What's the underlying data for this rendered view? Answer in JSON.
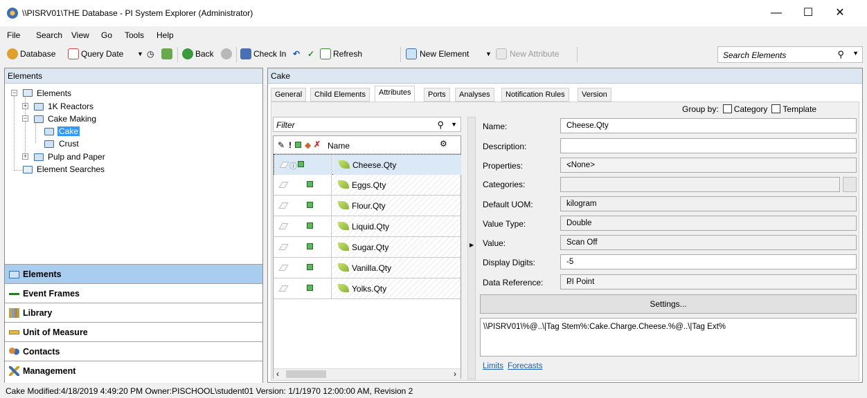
{
  "window": {
    "title": "\\\\PISRV01\\THE Database - PI System Explorer (Administrator)"
  },
  "menu": {
    "items": [
      "File",
      "Search",
      "View",
      "Go",
      "Tools",
      "Help"
    ]
  },
  "toolbar": {
    "database": "Database",
    "query_date": "Query Date",
    "back": "Back",
    "check_in": "Check In",
    "refresh": "Refresh",
    "new_element": "New Element",
    "new_attribute": "New Attribute",
    "search_placeholder": "Search Elements"
  },
  "left_pane": {
    "header": "Elements",
    "tree": {
      "root": "Elements",
      "reactors": "1K Reactors",
      "cake_making": "Cake Making",
      "cake": "Cake",
      "crust": "Crust",
      "pulp": "Pulp and Paper",
      "searches": "Element Searches"
    },
    "nav": [
      "Elements",
      "Event Frames",
      "Library",
      "Unit of Measure",
      "Contacts",
      "Management"
    ]
  },
  "right_pane": {
    "header": "Cake",
    "tabs": [
      "General",
      "Child Elements",
      "Attributes",
      "Ports",
      "Analyses",
      "Notification Rules",
      "Version"
    ],
    "group_by": {
      "label": "Group by:",
      "category": "Category",
      "template": "Template"
    },
    "filter_placeholder": "Filter",
    "grid_header": "Name",
    "attributes": [
      "Cheese.Qty",
      "Eggs.Qty",
      "Flour.Qty",
      "Liquid.Qty",
      "Sugar.Qty",
      "Vanilla.Qty",
      "Yolks.Qty"
    ],
    "details": {
      "name_label": "Name:",
      "name_value": "Cheese.Qty",
      "description_label": "Description:",
      "description_value": "",
      "properties_label": "Properties:",
      "properties_value": "<None>",
      "categories_label": "Categories:",
      "categories_value": "",
      "uom_label": "Default UOM:",
      "uom_value": "kilogram",
      "value_type_label": "Value Type:",
      "value_type_value": "Double",
      "value_label": "Value:",
      "value_value": "Scan Off",
      "digits_label": "Display Digits:",
      "digits_value": "-5",
      "data_ref_label": "Data Reference:",
      "data_ref_value": "PI Point",
      "settings_button": "Settings...",
      "path": "\\\\PISRV01\\%@..\\|Tag Stem%:Cake.Charge.Cheese.%@..\\|Tag Ext%",
      "limits_link": "Limits",
      "forecasts_link": "Forecasts"
    }
  },
  "status": "Cake  Modified:4/18/2019 4:49:20 PM Owner:PISCHOOL\\student01  Version: 1/1/1970 12:00:00 AM, Revision 2"
}
